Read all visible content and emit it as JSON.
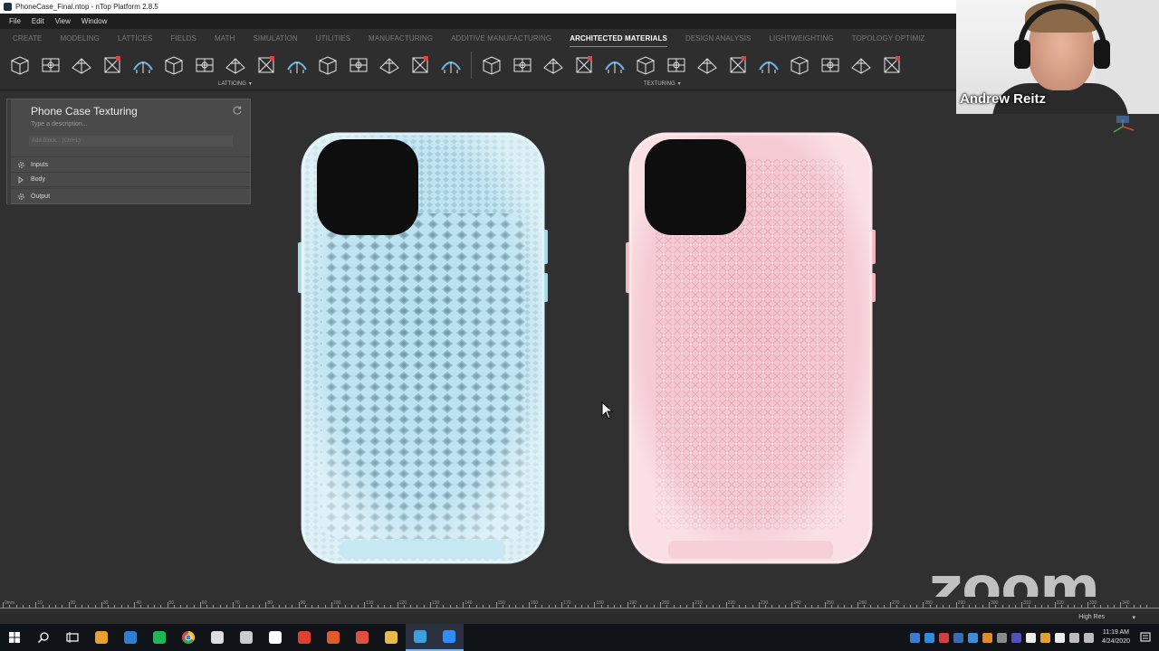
{
  "window": {
    "title": "PhoneCase_Final.ntop - nTop Platform 2.8.5"
  },
  "menu": [
    "File",
    "Edit",
    "View",
    "Window"
  ],
  "ribbon_tabs": [
    {
      "label": "CREATE",
      "active": false
    },
    {
      "label": "MODELING",
      "active": false
    },
    {
      "label": "LATTICES",
      "active": false
    },
    {
      "label": "FIELDS",
      "active": false
    },
    {
      "label": "MATH",
      "active": false
    },
    {
      "label": "SIMULATION",
      "active": false
    },
    {
      "label": "UTILITIES",
      "active": false
    },
    {
      "label": "MANUFACTURING",
      "active": false
    },
    {
      "label": "ADDITIVE MANUFACTURING",
      "active": false
    },
    {
      "label": "ARCHITECTED MATERIALS",
      "active": true
    },
    {
      "label": "DESIGN ANALYSIS",
      "active": false
    },
    {
      "label": "LIGHTWEIGHTING",
      "active": false
    },
    {
      "label": "TOPOLOGY OPTIMIZ",
      "active": false
    }
  ],
  "toolbar": {
    "groups": [
      {
        "label": "LATTICING",
        "caret": "▾"
      },
      {
        "label": "TEXTURING",
        "caret": "▾"
      }
    ]
  },
  "panel": {
    "title": "Phone Case Texturing",
    "description_placeholder": "Type a description...",
    "add_block_placeholder": "Add Block... (Ctrl+L)",
    "rows": [
      {
        "label": "Inputs",
        "icon": "gear-icon"
      },
      {
        "label": "Body",
        "icon": "play-icon"
      },
      {
        "label": "Output",
        "icon": "gear-icon"
      }
    ]
  },
  "webcam": {
    "name": "Andrew Reitz"
  },
  "watermark": "zoom",
  "ruler": {
    "labels": [
      "0mm",
      "10",
      "20",
      "30",
      "40",
      "50",
      "60",
      "70",
      "80",
      "90",
      "100",
      "110",
      "120",
      "130",
      "140",
      "150",
      "160",
      "170",
      "180",
      "190",
      "200",
      "210",
      "220",
      "230",
      "240",
      "250",
      "260",
      "270",
      "280",
      "290",
      "300",
      "310",
      "320",
      "330",
      "340"
    ]
  },
  "status": {
    "quality": "High Res",
    "caret": "▾"
  },
  "clock": {
    "time": "11:19 AM",
    "date": "4/24/2020"
  },
  "colors": {
    "phone_left": "#b6e0ef",
    "phone_right": "#f4c1cb",
    "accent": "#3a9be0",
    "viewport_bg": "#303030"
  },
  "taskbar": {
    "items": [
      {
        "icon": "windows-start-icon"
      },
      {
        "icon": "search-icon"
      },
      {
        "icon": "task-view-icon"
      },
      {
        "icon": "app-icon"
      },
      {
        "icon": "vscode-icon"
      },
      {
        "icon": "spotify-icon"
      },
      {
        "icon": "chrome-icon"
      },
      {
        "icon": "browser-icon"
      },
      {
        "icon": "terminal-icon"
      },
      {
        "icon": "app-icon"
      },
      {
        "icon": "pdf-icon"
      },
      {
        "icon": "app-icon"
      },
      {
        "icon": "app-icon"
      },
      {
        "icon": "folder-icon"
      },
      {
        "icon": "ntop-icon"
      },
      {
        "icon": "zoom-icon"
      }
    ]
  }
}
